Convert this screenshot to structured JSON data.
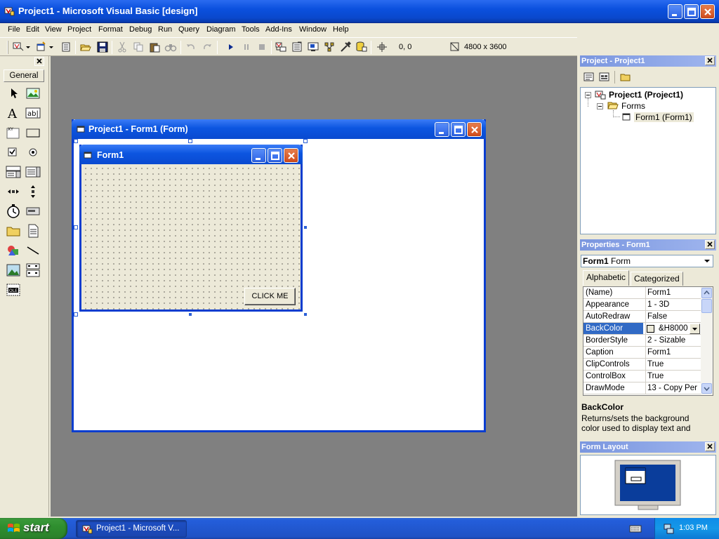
{
  "app": {
    "title": "Project1 - Microsoft Visual Basic [design]"
  },
  "menu": [
    "File",
    "Edit",
    "View",
    "Project",
    "Format",
    "Debug",
    "Run",
    "Query",
    "Diagram",
    "Tools",
    "Add-Ins",
    "Window",
    "Help"
  ],
  "toolbar": {
    "position": "0, 0",
    "size": "4800 x 3600"
  },
  "toolbox": {
    "tab_label": "General"
  },
  "designer": {
    "title": "Project1 - Form1 (Form)"
  },
  "form": {
    "title": "Form1",
    "button_caption": "CLICK ME"
  },
  "project_pane": {
    "title": "Project - Project1",
    "tree": {
      "project": "Project1 (Project1)",
      "folder": "Forms",
      "form": "Form1 (Form1)"
    }
  },
  "properties_pane": {
    "title": "Properties - Form1",
    "object_name": "Form1",
    "object_type": "Form",
    "tabs": [
      "Alphabetic",
      "Categorized"
    ],
    "rows": [
      {
        "name": "(Name)",
        "value": "Form1"
      },
      {
        "name": "Appearance",
        "value": "1 - 3D"
      },
      {
        "name": "AutoRedraw",
        "value": "False"
      },
      {
        "name": "BackColor",
        "value": "&H8000"
      },
      {
        "name": "BorderStyle",
        "value": "2 - Sizable"
      },
      {
        "name": "Caption",
        "value": "Form1"
      },
      {
        "name": "ClipControls",
        "value": "True"
      },
      {
        "name": "ControlBox",
        "value": "True"
      },
      {
        "name": "DrawMode",
        "value": "13 - Copy Per"
      }
    ],
    "selected_row": 3,
    "description_title": "BackColor",
    "description_text": "Returns/sets the background color used to display text and"
  },
  "layout_pane": {
    "title": "Form Layout"
  },
  "taskbar": {
    "start_label": "start",
    "task_label": "Project1 - Microsoft V...",
    "clock": "1:03 PM"
  },
  "colors": {
    "xp_blue": "#0a4ad0",
    "selection": "#316ac5",
    "mdi_bg": "#808080",
    "monitor_screen": "#0a3d9b"
  }
}
